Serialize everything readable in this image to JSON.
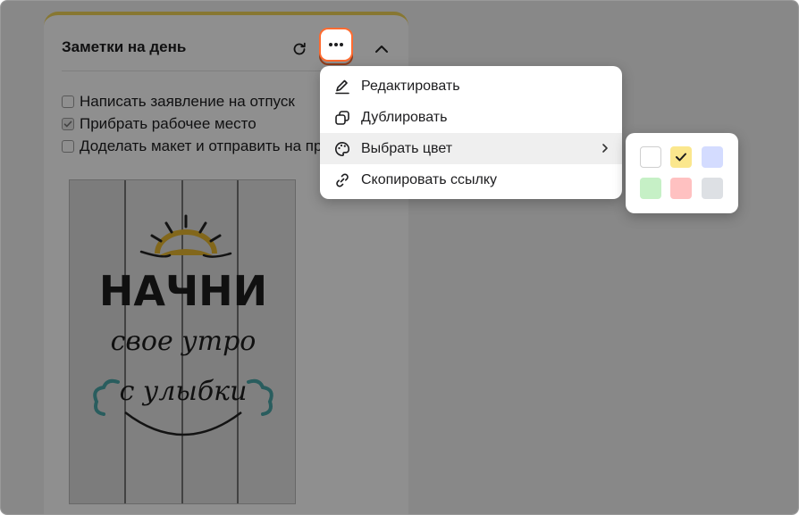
{
  "card": {
    "title": "Заметки на день",
    "accent": "#f1d45a"
  },
  "todos": [
    {
      "label": "Написать заявление на отпуск",
      "checked": false
    },
    {
      "label": "Прибрать рабочее место",
      "checked": true
    },
    {
      "label": "Доделать макет и отправить на проверку",
      "checked": false
    }
  ],
  "poster": {
    "line1": "НАЧНИ",
    "line2": "свое утро",
    "line3": "с улыбки"
  },
  "menu": {
    "items": [
      {
        "label": "Редактировать",
        "icon": "pencil-icon"
      },
      {
        "label": "Дублировать",
        "icon": "duplicate-icon"
      },
      {
        "label": "Выбрать цвет",
        "icon": "palette-icon",
        "has_submenu": true
      },
      {
        "label": "Скопировать ссылку",
        "icon": "link-icon"
      }
    ]
  },
  "colors": {
    "swatches": [
      {
        "name": "white",
        "color": "#ffffff",
        "selected": false
      },
      {
        "name": "yellow",
        "color": "#fbe78d",
        "selected": true
      },
      {
        "name": "blue",
        "color": "#d4dcff",
        "selected": false
      },
      {
        "name": "green",
        "color": "#c6f0c6",
        "selected": false
      },
      {
        "name": "red",
        "color": "#ffc1c1",
        "selected": false
      },
      {
        "name": "gray",
        "color": "#dde0e4",
        "selected": false
      }
    ],
    "focus": "#ff6b30"
  }
}
